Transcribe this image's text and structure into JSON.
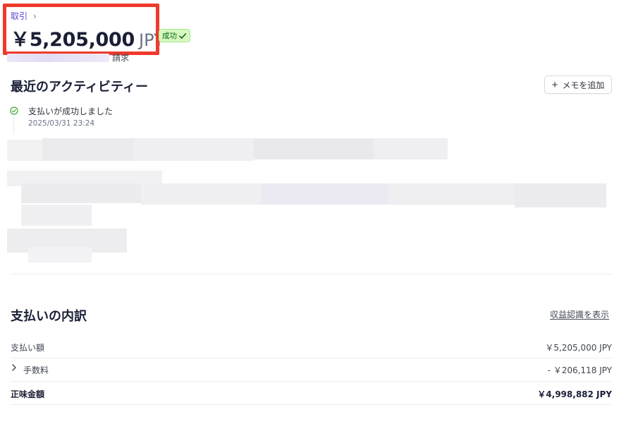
{
  "breadcrumb": {
    "label": "取引",
    "chevron": "›"
  },
  "header": {
    "amount": "￥5,205,000",
    "currency": "JPY",
    "status_badge": "成功",
    "description_suffix": "請求"
  },
  "activity": {
    "title": "最近のアクティビティー",
    "add_note_label": "メモを追加",
    "events": [
      {
        "title": "支払いが成功しました",
        "timestamp": "2025/03/31 23:24"
      }
    ]
  },
  "breakdown": {
    "title": "支払いの内訳",
    "revenue_link": "収益認識を表示",
    "rows": [
      {
        "label": "支払い額",
        "value": "￥5,205,000 JPY"
      },
      {
        "label": "手数料",
        "value": "- ￥206,118 JPY"
      },
      {
        "label": "正味金額",
        "value": "￥4,998,882 JPY"
      }
    ]
  },
  "colors": {
    "link": "#5a47d9",
    "highlight": "#ee3a2c",
    "success_bg": "#d7f7c2",
    "success_text": "#05690d"
  },
  "icons": {
    "badge": "checkmark-icon",
    "activity": "check-circle-icon",
    "note_button": "plus-icon",
    "fee_toggle": "chevron-right-icon"
  }
}
